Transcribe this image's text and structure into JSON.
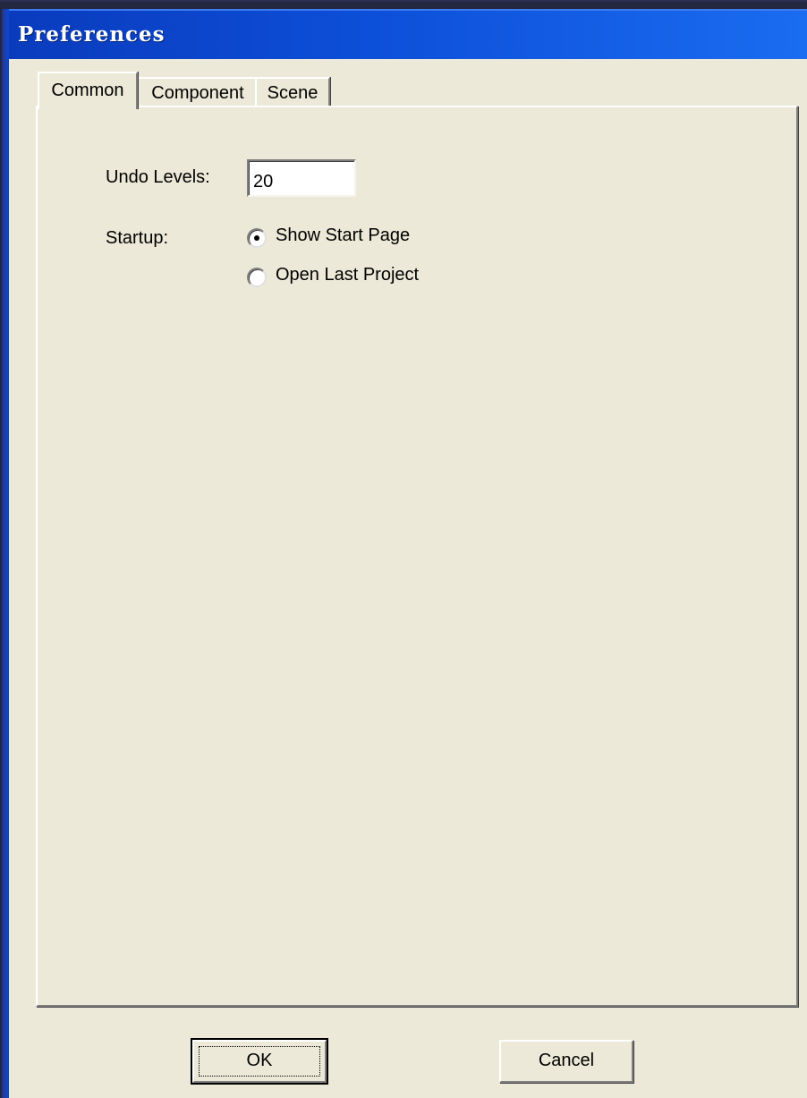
{
  "window": {
    "title": "Preferences"
  },
  "tabs": [
    {
      "label": "Common",
      "selected": true
    },
    {
      "label": "Component",
      "selected": false
    },
    {
      "label": "Scene",
      "selected": false
    }
  ],
  "common": {
    "undo_levels_label": "Undo Levels:",
    "undo_levels_value": "20",
    "startup_label": "Startup:",
    "startup_options": [
      {
        "label": "Show Start Page",
        "selected": true
      },
      {
        "label": "Open Last Project",
        "selected": false
      }
    ]
  },
  "buttons": {
    "ok_label": "OK",
    "cancel_label": "Cancel"
  },
  "colors": {
    "titlebar": "#0d4fd8",
    "dialog_background": "#ece9d8"
  }
}
